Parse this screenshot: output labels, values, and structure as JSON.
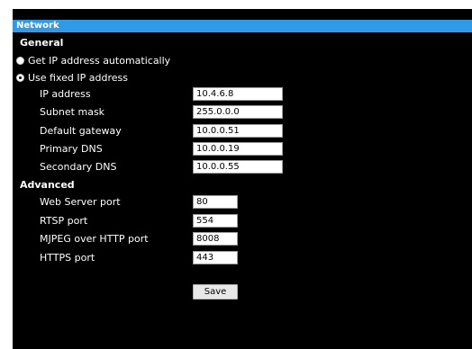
{
  "panel": {
    "title": "Network"
  },
  "general": {
    "heading": "General",
    "options": [
      {
        "label": "Get IP address automatically",
        "selected": false
      },
      {
        "label": "Use fixed IP address",
        "selected": true
      }
    ],
    "fields": [
      {
        "label": "IP address",
        "value": "10.4.6.8"
      },
      {
        "label": "Subnet mask",
        "value": "255.0.0.0"
      },
      {
        "label": "Default gateway",
        "value": "10.0.0.51"
      },
      {
        "label": "Primary DNS",
        "value": "10.0.0.19"
      },
      {
        "label": "Secondary DNS",
        "value": "10.0.0.55"
      }
    ]
  },
  "advanced": {
    "heading": "Advanced",
    "fields": [
      {
        "label": "Web Server port",
        "value": "80"
      },
      {
        "label": "RTSP port",
        "value": "554"
      },
      {
        "label": "MJPEG over HTTP port",
        "value": "8008"
      },
      {
        "label": "HTTPS port",
        "value": "443"
      }
    ]
  },
  "actions": {
    "save_label": "Save"
  },
  "colors": {
    "title_bar": "#2f9be8",
    "panel_background": "#000000",
    "page_background": "#ffffff"
  }
}
